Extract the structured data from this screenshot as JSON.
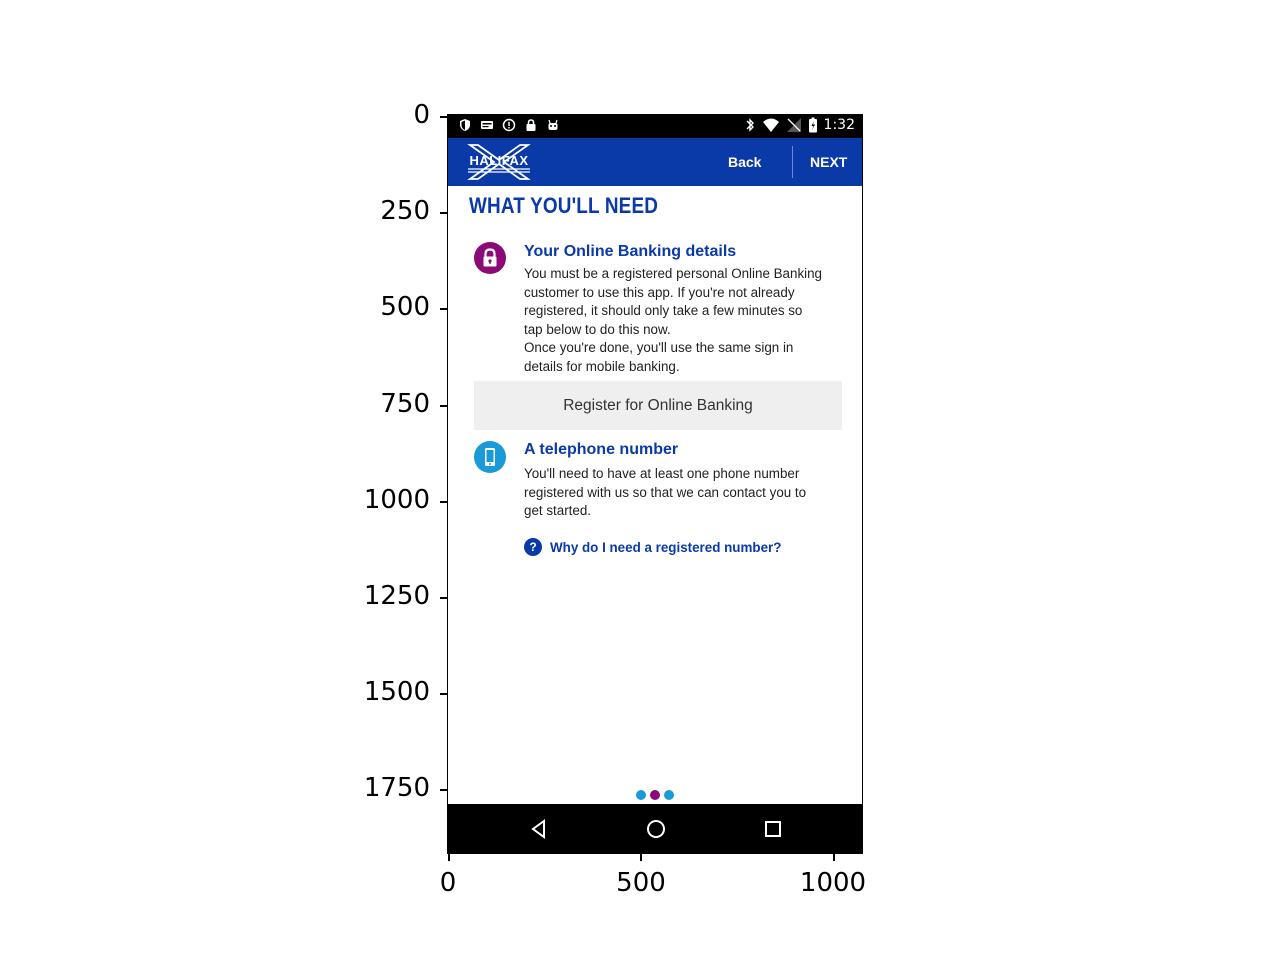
{
  "axes": {
    "y_ticks": [
      "0",
      "250",
      "500",
      "750",
      "1000",
      "1250",
      "1500",
      "1750"
    ],
    "x_ticks": [
      "0",
      "500",
      "1000"
    ]
  },
  "status_bar": {
    "left_icons": [
      "shield-icon",
      "card-icon",
      "alert-icon",
      "lock-icon",
      "android-icon"
    ],
    "right_icons": [
      "bluetooth-icon",
      "wifi-icon",
      "no-signal-icon",
      "battery-icon"
    ],
    "time": "1:32"
  },
  "header": {
    "logo_text": "HALIFAX",
    "back_label": "Back",
    "next_label": "NEXT"
  },
  "page": {
    "title": "WHAT YOU'LL NEED",
    "sections": [
      {
        "icon": "padlock-icon",
        "title": "Your Online Banking details",
        "lines": [
          "You must be a registered personal Online Banking",
          "customer to use this app. If you're not already",
          "registered, it should only take a few minutes so",
          "tap below to do this now.",
          "Once you're done, you'll use the same sign in",
          "details for mobile banking."
        ]
      },
      {
        "icon": "mobile-phone-icon",
        "title": "A telephone number",
        "lines": [
          "You'll need to have at least one phone number",
          "registered with us so that we can contact you to",
          "get started."
        ]
      }
    ],
    "register_button": "Register for Online Banking",
    "help_link": "Why do I need a registered number?",
    "help_icon_glyph": "?"
  },
  "pager": {
    "current": 2,
    "total": 3
  },
  "colors": {
    "brand_blue": "#0a3aa8",
    "purple": "#8a0a78",
    "cyan": "#1a9ad6"
  },
  "nav_bar": {
    "buttons": [
      "back-triangle-icon",
      "home-circle-icon",
      "recents-square-icon"
    ]
  }
}
